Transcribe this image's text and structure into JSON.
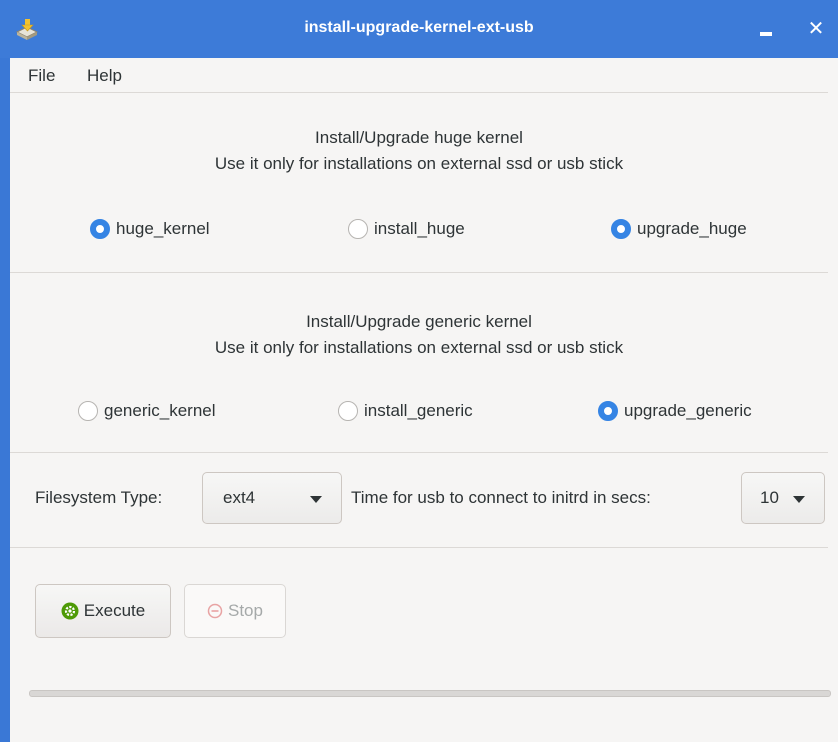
{
  "window": {
    "title": "install-upgrade-kernel-ext-usb"
  },
  "menu": {
    "file": "File",
    "help": "Help"
  },
  "huge": {
    "heading_line1": "Install/Upgrade huge kernel",
    "heading_line2": "Use it only for installations on external ssd or usb stick",
    "options": [
      {
        "label": "huge_kernel",
        "checked": true
      },
      {
        "label": "install_huge",
        "checked": false
      },
      {
        "label": "upgrade_huge",
        "checked": true
      }
    ]
  },
  "generic": {
    "heading_line1": "Install/Upgrade generic kernel",
    "heading_line2": "Use it only for installations on external ssd or usb stick",
    "options": [
      {
        "label": "generic_kernel",
        "checked": false
      },
      {
        "label": "install_generic",
        "checked": false
      },
      {
        "label": "upgrade_generic",
        "checked": true
      }
    ]
  },
  "settings": {
    "fs_label": "Filesystem Type:",
    "fs_value": "ext4",
    "time_label": "Time for usb to connect to initrd in secs:",
    "time_value": "10"
  },
  "actions": {
    "execute": "Execute",
    "stop": "Stop",
    "stop_enabled": false
  },
  "progress": {
    "fraction": 0
  },
  "colors": {
    "accent": "#3584e4",
    "titlebar": "#3d7bd8",
    "execute_icon": "#4e9a06"
  }
}
